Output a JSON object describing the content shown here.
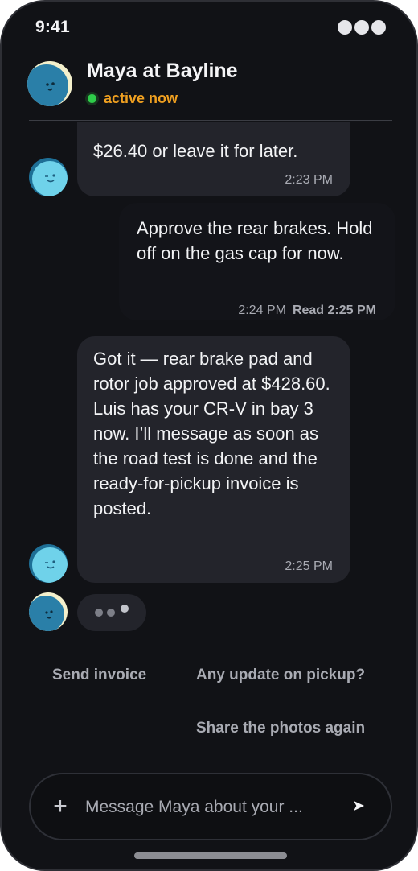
{
  "status_bar": {
    "time": "9:41"
  },
  "header": {
    "contact_name": "Maya at Bayline",
    "presence": "active now"
  },
  "messages": [
    {
      "from": "agent",
      "text": "$26.40 or leave it for later.",
      "time": "2:23 PM"
    },
    {
      "from": "user",
      "text": "Approve the rear brakes. Hold off on the gas cap for now.",
      "time": "2:24 PM",
      "read": "Read 2:25 PM"
    },
    {
      "from": "agent",
      "text": "Got it — rear brake pad and rotor job approved at $428.60. Luis has your CR-V in bay 3 now. I’ll message as soon as the road test is done and the ready-for-pickup invoice is posted.",
      "time": "2:25 PM"
    }
  ],
  "suggestions": [
    "Send invoice",
    "Any update on pickup?",
    "Share the photos again"
  ],
  "composer": {
    "placeholder": "Message Maya about your ...",
    "plus_icon": "+",
    "send_icon": "➤"
  },
  "colors": {
    "background": "#111216",
    "bubble": "#23242b",
    "presence_green": "#2ecc4a",
    "presence_text": "#f0a020",
    "muted_text": "#a9abb3"
  },
  "icons": [
    "avatar-icon",
    "plus-icon",
    "send-icon",
    "typing-indicator"
  ]
}
